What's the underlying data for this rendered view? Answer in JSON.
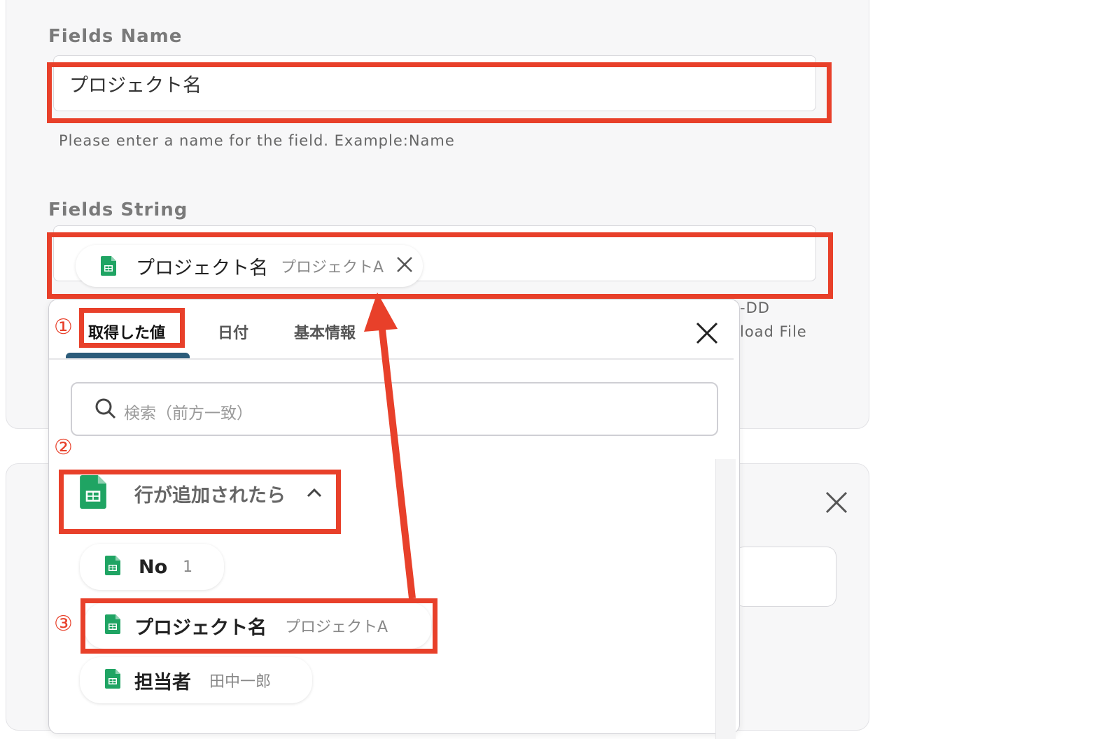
{
  "form": {
    "fields_name": {
      "label": "Fields Name",
      "value": "プロジェクト名",
      "hint": "Please enter a name for the field. Example:Name"
    },
    "fields_string": {
      "label": "Fields String",
      "chip": {
        "name": "プロジェクト名",
        "value": "プロジェクトA"
      }
    },
    "peek_texts": [
      "-DD",
      "load File"
    ]
  },
  "popup": {
    "tabs": [
      {
        "label": "取得した値",
        "active": true
      },
      {
        "label": "日付",
        "active": false
      },
      {
        "label": "基本情報",
        "active": false
      }
    ],
    "search_placeholder": "検索（前方一致）",
    "group": {
      "title": "行が追加されたら"
    },
    "items": [
      {
        "name": "No",
        "value": "1"
      },
      {
        "name": "プロジェクト名",
        "value": "プロジェクトA"
      },
      {
        "name": "担当者",
        "value": "田中一郎"
      }
    ]
  },
  "annotations": {
    "step1": "①",
    "step2": "②",
    "step3": "③",
    "color": "#e8402a"
  },
  "icons": [
    "sheets-icon",
    "close-icon",
    "search-icon",
    "chevron-up-icon"
  ]
}
